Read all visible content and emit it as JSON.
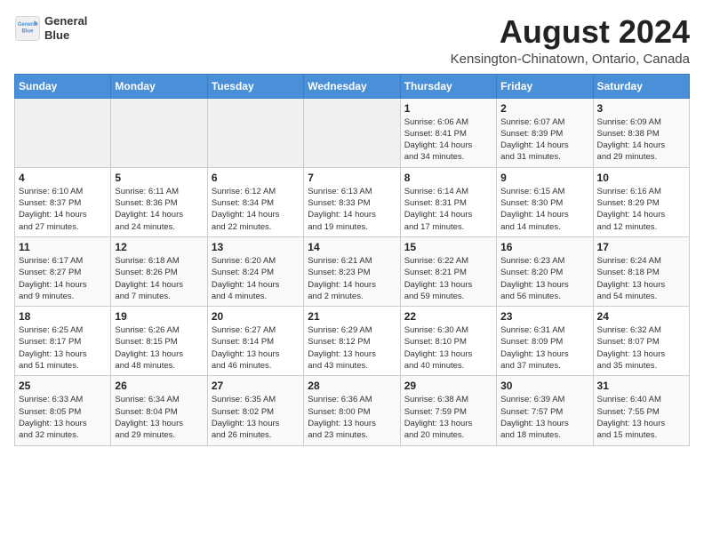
{
  "logo": {
    "line1": "General",
    "line2": "Blue"
  },
  "title": "August 2024",
  "subtitle": "Kensington-Chinatown, Ontario, Canada",
  "weekdays": [
    "Sunday",
    "Monday",
    "Tuesday",
    "Wednesday",
    "Thursday",
    "Friday",
    "Saturday"
  ],
  "weeks": [
    [
      {
        "day": "",
        "info": ""
      },
      {
        "day": "",
        "info": ""
      },
      {
        "day": "",
        "info": ""
      },
      {
        "day": "",
        "info": ""
      },
      {
        "day": "1",
        "info": "Sunrise: 6:06 AM\nSunset: 8:41 PM\nDaylight: 14 hours\nand 34 minutes."
      },
      {
        "day": "2",
        "info": "Sunrise: 6:07 AM\nSunset: 8:39 PM\nDaylight: 14 hours\nand 31 minutes."
      },
      {
        "day": "3",
        "info": "Sunrise: 6:09 AM\nSunset: 8:38 PM\nDaylight: 14 hours\nand 29 minutes."
      }
    ],
    [
      {
        "day": "4",
        "info": "Sunrise: 6:10 AM\nSunset: 8:37 PM\nDaylight: 14 hours\nand 27 minutes."
      },
      {
        "day": "5",
        "info": "Sunrise: 6:11 AM\nSunset: 8:36 PM\nDaylight: 14 hours\nand 24 minutes."
      },
      {
        "day": "6",
        "info": "Sunrise: 6:12 AM\nSunset: 8:34 PM\nDaylight: 14 hours\nand 22 minutes."
      },
      {
        "day": "7",
        "info": "Sunrise: 6:13 AM\nSunset: 8:33 PM\nDaylight: 14 hours\nand 19 minutes."
      },
      {
        "day": "8",
        "info": "Sunrise: 6:14 AM\nSunset: 8:31 PM\nDaylight: 14 hours\nand 17 minutes."
      },
      {
        "day": "9",
        "info": "Sunrise: 6:15 AM\nSunset: 8:30 PM\nDaylight: 14 hours\nand 14 minutes."
      },
      {
        "day": "10",
        "info": "Sunrise: 6:16 AM\nSunset: 8:29 PM\nDaylight: 14 hours\nand 12 minutes."
      }
    ],
    [
      {
        "day": "11",
        "info": "Sunrise: 6:17 AM\nSunset: 8:27 PM\nDaylight: 14 hours\nand 9 minutes."
      },
      {
        "day": "12",
        "info": "Sunrise: 6:18 AM\nSunset: 8:26 PM\nDaylight: 14 hours\nand 7 minutes."
      },
      {
        "day": "13",
        "info": "Sunrise: 6:20 AM\nSunset: 8:24 PM\nDaylight: 14 hours\nand 4 minutes."
      },
      {
        "day": "14",
        "info": "Sunrise: 6:21 AM\nSunset: 8:23 PM\nDaylight: 14 hours\nand 2 minutes."
      },
      {
        "day": "15",
        "info": "Sunrise: 6:22 AM\nSunset: 8:21 PM\nDaylight: 13 hours\nand 59 minutes."
      },
      {
        "day": "16",
        "info": "Sunrise: 6:23 AM\nSunset: 8:20 PM\nDaylight: 13 hours\nand 56 minutes."
      },
      {
        "day": "17",
        "info": "Sunrise: 6:24 AM\nSunset: 8:18 PM\nDaylight: 13 hours\nand 54 minutes."
      }
    ],
    [
      {
        "day": "18",
        "info": "Sunrise: 6:25 AM\nSunset: 8:17 PM\nDaylight: 13 hours\nand 51 minutes."
      },
      {
        "day": "19",
        "info": "Sunrise: 6:26 AM\nSunset: 8:15 PM\nDaylight: 13 hours\nand 48 minutes."
      },
      {
        "day": "20",
        "info": "Sunrise: 6:27 AM\nSunset: 8:14 PM\nDaylight: 13 hours\nand 46 minutes."
      },
      {
        "day": "21",
        "info": "Sunrise: 6:29 AM\nSunset: 8:12 PM\nDaylight: 13 hours\nand 43 minutes."
      },
      {
        "day": "22",
        "info": "Sunrise: 6:30 AM\nSunset: 8:10 PM\nDaylight: 13 hours\nand 40 minutes."
      },
      {
        "day": "23",
        "info": "Sunrise: 6:31 AM\nSunset: 8:09 PM\nDaylight: 13 hours\nand 37 minutes."
      },
      {
        "day": "24",
        "info": "Sunrise: 6:32 AM\nSunset: 8:07 PM\nDaylight: 13 hours\nand 35 minutes."
      }
    ],
    [
      {
        "day": "25",
        "info": "Sunrise: 6:33 AM\nSunset: 8:05 PM\nDaylight: 13 hours\nand 32 minutes."
      },
      {
        "day": "26",
        "info": "Sunrise: 6:34 AM\nSunset: 8:04 PM\nDaylight: 13 hours\nand 29 minutes."
      },
      {
        "day": "27",
        "info": "Sunrise: 6:35 AM\nSunset: 8:02 PM\nDaylight: 13 hours\nand 26 minutes."
      },
      {
        "day": "28",
        "info": "Sunrise: 6:36 AM\nSunset: 8:00 PM\nDaylight: 13 hours\nand 23 minutes."
      },
      {
        "day": "29",
        "info": "Sunrise: 6:38 AM\nSunset: 7:59 PM\nDaylight: 13 hours\nand 20 minutes."
      },
      {
        "day": "30",
        "info": "Sunrise: 6:39 AM\nSunset: 7:57 PM\nDaylight: 13 hours\nand 18 minutes."
      },
      {
        "day": "31",
        "info": "Sunrise: 6:40 AM\nSunset: 7:55 PM\nDaylight: 13 hours\nand 15 minutes."
      }
    ]
  ]
}
